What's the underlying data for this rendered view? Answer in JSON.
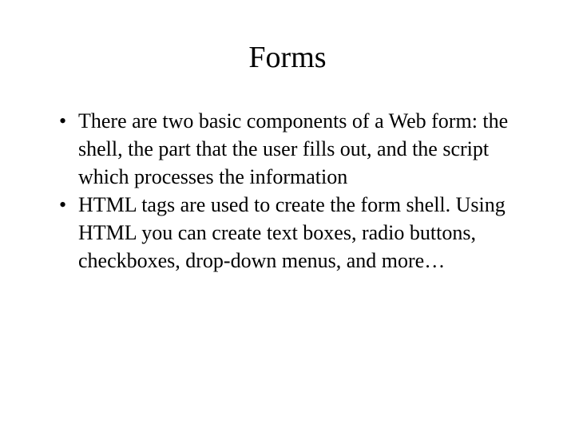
{
  "slide": {
    "title": "Forms",
    "bullets": [
      "There are two basic components of a Web form: the shell, the part that the user fills out, and the script which processes the information",
      "HTML tags are used to create the form shell. Using HTML you can create text boxes, radio buttons, checkboxes, drop-down menus, and more…"
    ]
  }
}
